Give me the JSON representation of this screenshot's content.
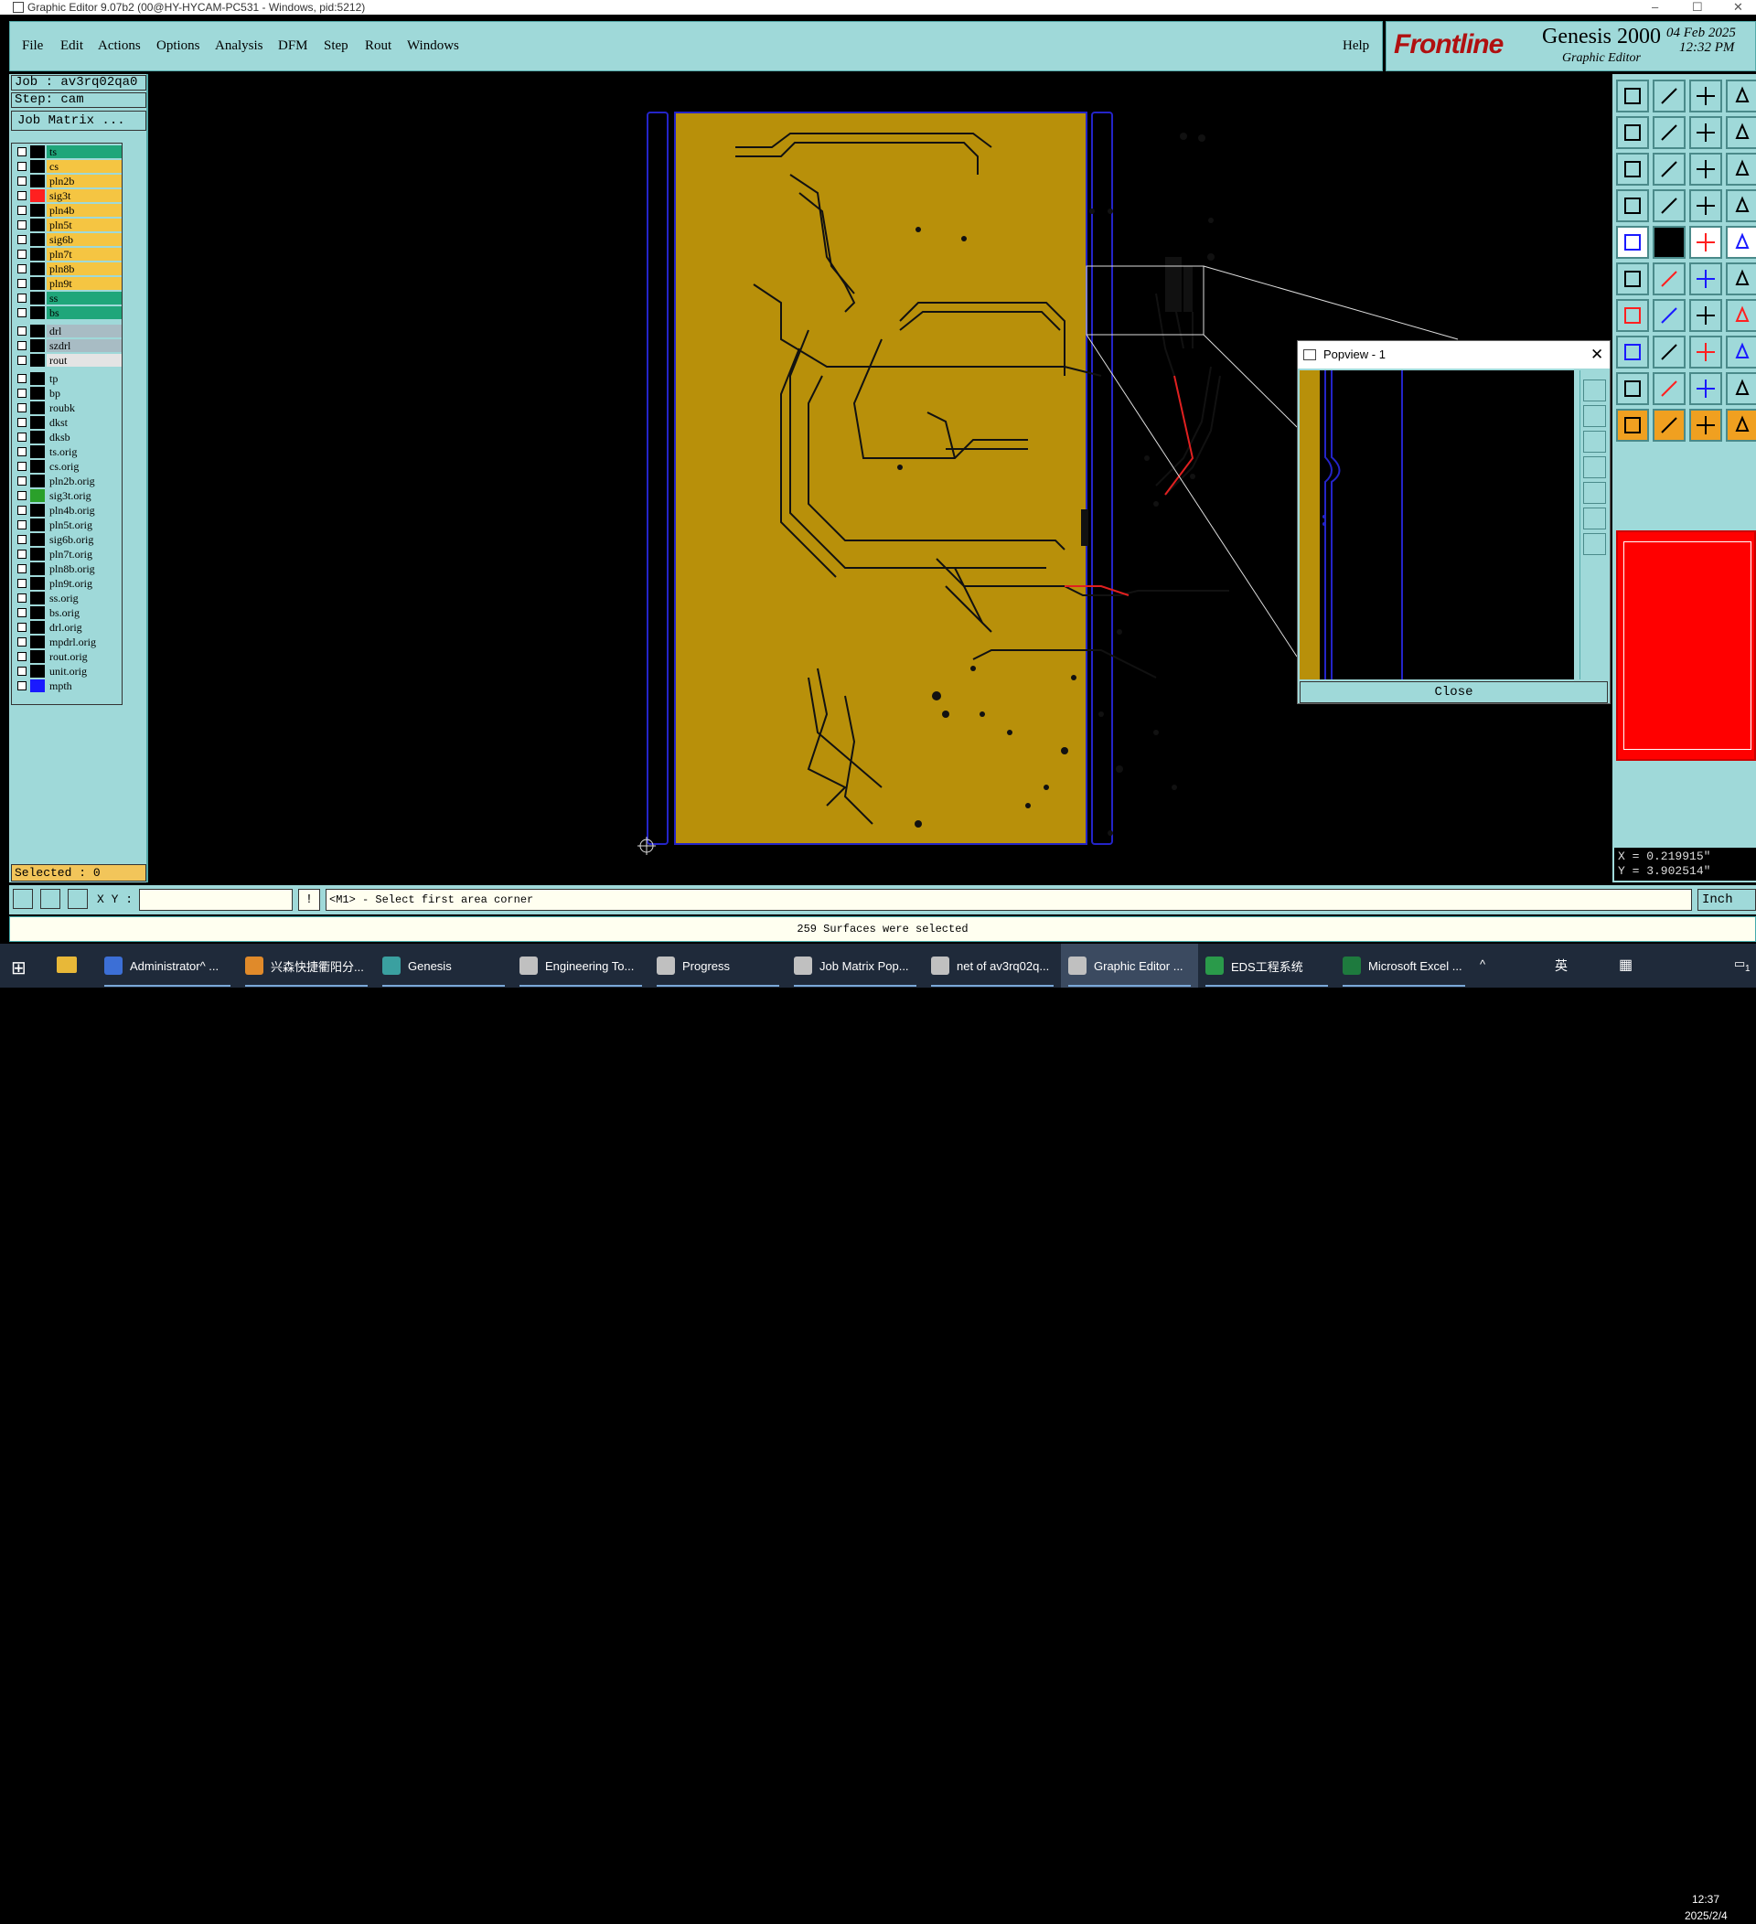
{
  "window": {
    "title": "Graphic Editor 9.07b2 (00@HY-HYCAM-PC531 - Windows, pid:5212)",
    "controls": [
      "–",
      "☐",
      "✕"
    ]
  },
  "menu": {
    "items": [
      "File",
      "Edit",
      "Actions",
      "Options",
      "Analysis",
      "DFM",
      "Step",
      "Rout",
      "Windows"
    ],
    "help": "Help"
  },
  "brand": {
    "logo": "Frontline",
    "product": "Genesis 2000",
    "subtitle": "Graphic Editor",
    "date": "04 Feb 2025",
    "time": "12:32 PM"
  },
  "job": {
    "job_label": "Job : av3rq02qa0",
    "step_label": "Step: cam",
    "matrix_button": "Job Matrix ..."
  },
  "layers": [
    {
      "name": "ts",
      "color": "#1fa67a",
      "swatch": "#000"
    },
    {
      "name": "cs",
      "color": "#f5c542",
      "swatch": "#000"
    },
    {
      "name": "pln2b",
      "color": "#f5c542",
      "swatch": "#000"
    },
    {
      "name": "sig3t",
      "color": "#f5c542",
      "swatch": "#ff2020"
    },
    {
      "name": "pln4b",
      "color": "#f5c542",
      "swatch": "#000"
    },
    {
      "name": "pln5t",
      "color": "#f5c542",
      "swatch": "#000"
    },
    {
      "name": "sig6b",
      "color": "#f5c542",
      "swatch": "#000"
    },
    {
      "name": "pln7t",
      "color": "#f5c542",
      "swatch": "#000"
    },
    {
      "name": "pln8b",
      "color": "#f5c542",
      "swatch": "#000"
    },
    {
      "name": "pln9t",
      "color": "#f5c542",
      "swatch": "#000"
    },
    {
      "name": "ss",
      "color": "#1fa67a",
      "swatch": "#000"
    },
    {
      "name": "bs",
      "color": "#1fa67a",
      "swatch": "#000"
    },
    {
      "name": "drl",
      "color": "#a8bcc4",
      "swatch": "#000"
    },
    {
      "name": "szdrl",
      "color": "#a8bcc4",
      "swatch": "#000"
    },
    {
      "name": "rout",
      "color": "#e4e4e4",
      "swatch": "#000"
    },
    {
      "name": "tp",
      "color": "#9fd9d9",
      "swatch": "#000"
    },
    {
      "name": "bp",
      "color": "#9fd9d9",
      "swatch": "#000"
    },
    {
      "name": "roubk",
      "color": "#9fd9d9",
      "swatch": "#000"
    },
    {
      "name": "dkst",
      "color": "#9fd9d9",
      "swatch": "#000"
    },
    {
      "name": "dksb",
      "color": "#9fd9d9",
      "swatch": "#000"
    },
    {
      "name": "ts.orig",
      "color": "#9fd9d9",
      "swatch": "#000"
    },
    {
      "name": "cs.orig",
      "color": "#9fd9d9",
      "swatch": "#000"
    },
    {
      "name": "pln2b.orig",
      "color": "#9fd9d9",
      "swatch": "#000"
    },
    {
      "name": "sig3t.orig",
      "color": "#9fd9d9",
      "swatch": "#2aa02a"
    },
    {
      "name": "pln4b.orig",
      "color": "#9fd9d9",
      "swatch": "#000"
    },
    {
      "name": "pln5t.orig",
      "color": "#9fd9d9",
      "swatch": "#000"
    },
    {
      "name": "sig6b.orig",
      "color": "#9fd9d9",
      "swatch": "#000"
    },
    {
      "name": "pln7t.orig",
      "color": "#9fd9d9",
      "swatch": "#000"
    },
    {
      "name": "pln8b.orig",
      "color": "#9fd9d9",
      "swatch": "#000"
    },
    {
      "name": "pln9t.orig",
      "color": "#9fd9d9",
      "swatch": "#000"
    },
    {
      "name": "ss.orig",
      "color": "#9fd9d9",
      "swatch": "#000"
    },
    {
      "name": "bs.orig",
      "color": "#9fd9d9",
      "swatch": "#000"
    },
    {
      "name": "drl.orig",
      "color": "#9fd9d9",
      "swatch": "#000"
    },
    {
      "name": "mpdrl.orig",
      "color": "#9fd9d9",
      "swatch": "#000"
    },
    {
      "name": "rout.orig",
      "color": "#9fd9d9",
      "swatch": "#000"
    },
    {
      "name": "unit.orig",
      "color": "#9fd9d9",
      "swatch": "#000"
    },
    {
      "name": "mpth",
      "color": "#9fd9d9",
      "swatch": "#1a1aff"
    }
  ],
  "selected": "Selected : 0",
  "coords": {
    "x": "X = 0.219915\"",
    "y": "Y = 3.902514\""
  },
  "command": {
    "xy_label": "X Y :",
    "xy_value": "",
    "prompt": "<M1> - Select first area corner",
    "unit": "Inch"
  },
  "status_message": "259 Surfaces were selected",
  "popview": {
    "title": "Popview - 1",
    "close_label": "Close"
  },
  "taskbar": {
    "items": [
      {
        "label": "Administrator^ ...",
        "color": "#3c6fd6"
      },
      {
        "label": "兴森快捷衢阳分...",
        "color": "#e08a2a"
      },
      {
        "label": "Genesis",
        "color": "#3aa0a0"
      },
      {
        "label": "Engineering To...",
        "color": "#c0c0c0"
      },
      {
        "label": "Progress",
        "color": "#c0c0c0"
      },
      {
        "label": "Job Matrix Pop...",
        "color": "#c0c0c0"
      },
      {
        "label": "net of av3rq02q...",
        "color": "#c0c0c0"
      },
      {
        "label": "Graphic Editor ...",
        "color": "#c0c0c0"
      },
      {
        "label": "EDS工程系统",
        "color": "#2a9a4a"
      },
      {
        "label": "Microsoft Excel ...",
        "color": "#1e7a3e"
      }
    ],
    "tray_lang": "英",
    "time": "12:37",
    "date": "2025/2/4",
    "notification": "1"
  }
}
